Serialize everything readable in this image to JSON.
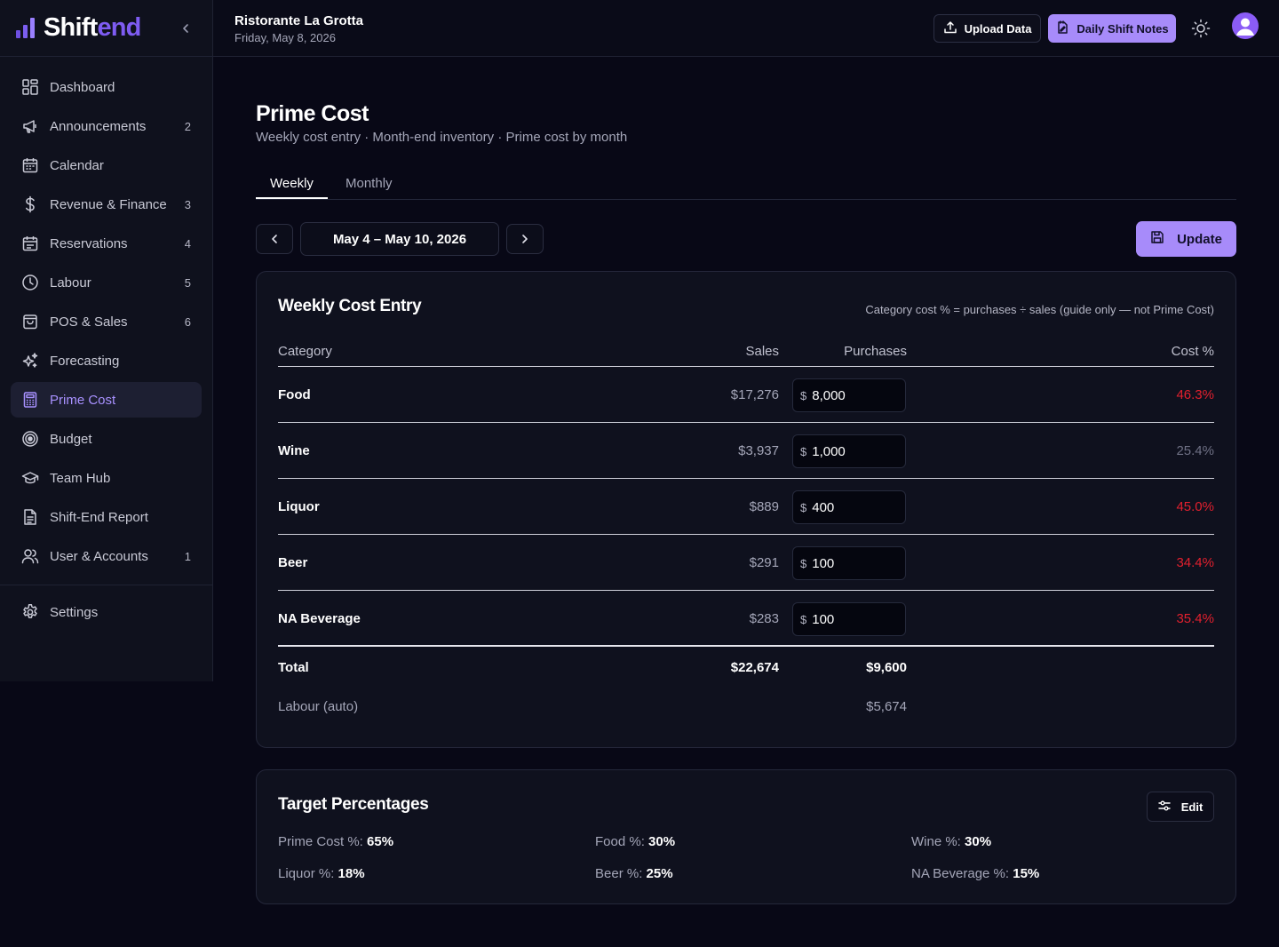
{
  "brand": {
    "part1": "Shift",
    "part2": "end"
  },
  "header": {
    "restaurant": "Ristorante La Grotta",
    "date": "Friday, May 8, 2026",
    "upload_label": "Upload Data",
    "notes_label": "Daily Shift Notes"
  },
  "sidebar": {
    "items": [
      {
        "label": "Dashboard",
        "badge": "",
        "icon": "dashboard-icon"
      },
      {
        "label": "Announcements",
        "badge": "2",
        "icon": "megaphone-icon"
      },
      {
        "label": "Calendar",
        "badge": "",
        "icon": "calendar-icon"
      },
      {
        "label": "Revenue & Finance",
        "badge": "3",
        "icon": "dollar-icon"
      },
      {
        "label": "Reservations",
        "badge": "4",
        "icon": "calendar-grid-icon"
      },
      {
        "label": "Labour",
        "badge": "5",
        "icon": "clock-icon"
      },
      {
        "label": "POS & Sales",
        "badge": "6",
        "icon": "bag-icon"
      },
      {
        "label": "Forecasting",
        "badge": "",
        "icon": "sparkles-icon"
      },
      {
        "label": "Prime Cost",
        "badge": "",
        "icon": "calculator-icon"
      },
      {
        "label": "Budget",
        "badge": "",
        "icon": "target-icon"
      },
      {
        "label": "Team Hub",
        "badge": "",
        "icon": "graduation-cap-icon"
      },
      {
        "label": "Shift-End Report",
        "badge": "",
        "icon": "document-icon"
      },
      {
        "label": "User & Accounts",
        "badge": "1",
        "icon": "users-icon"
      }
    ],
    "settings_label": "Settings"
  },
  "page": {
    "title": "Prime Cost",
    "subtitle": "Weekly cost entry · Month-end inventory · Prime cost by month",
    "tabs": [
      "Weekly",
      "Monthly"
    ],
    "week_range": "May 4 – May 10, 2026",
    "update_label": "Update"
  },
  "cost_entry": {
    "title": "Weekly Cost Entry",
    "note": "Category cost % = purchases ÷ sales (guide only — not Prime Cost)",
    "headers": {
      "category": "Category",
      "sales": "Sales",
      "purchases": "Purchases",
      "cost_pct": "Cost %"
    },
    "currency_symbol": "$",
    "rows": [
      {
        "category": "Food",
        "sales": "$17,276",
        "purchases": "8,000",
        "cost_pct": "46.3%",
        "status": "over"
      },
      {
        "category": "Wine",
        "sales": "$3,937",
        "purchases": "1,000",
        "cost_pct": "25.4%",
        "status": "ok"
      },
      {
        "category": "Liquor",
        "sales": "$889",
        "purchases": "400",
        "cost_pct": "45.0%",
        "status": "over"
      },
      {
        "category": "Beer",
        "sales": "$291",
        "purchases": "100",
        "cost_pct": "34.4%",
        "status": "over"
      },
      {
        "category": "NA Beverage",
        "sales": "$283",
        "purchases": "100",
        "cost_pct": "35.4%",
        "status": "over"
      }
    ],
    "total": {
      "label": "Total",
      "sales": "$22,674",
      "purchases": "$9,600"
    },
    "labour": {
      "label": "Labour (auto)",
      "value": "$5,674"
    }
  },
  "targets": {
    "title": "Target Percentages",
    "edit_label": "Edit",
    "items": [
      {
        "label": "Prime Cost %:",
        "value": "65%"
      },
      {
        "label": "Food %:",
        "value": "30%"
      },
      {
        "label": "Wine %:",
        "value": "30%"
      },
      {
        "label": "Liquor %:",
        "value": "18%"
      },
      {
        "label": "Beer %:",
        "value": "25%"
      },
      {
        "label": "NA Beverage %:",
        "value": "15%"
      }
    ]
  },
  "colors": {
    "accent": "#a78bfa",
    "over_target": "#e2202e",
    "background": "#080816"
  }
}
